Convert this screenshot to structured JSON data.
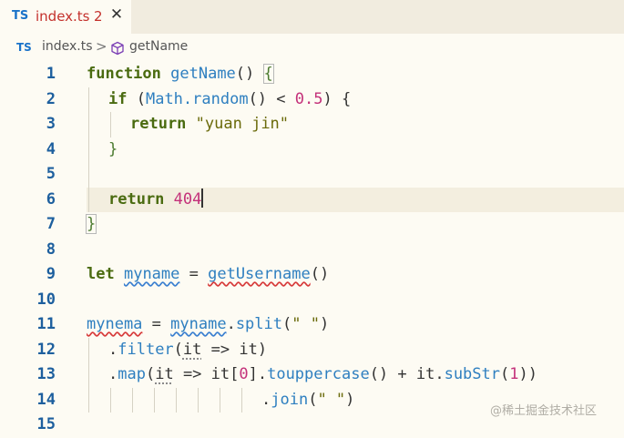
{
  "tab": {
    "lang": "TS",
    "filename": "index.ts",
    "problems": "2",
    "close_icon": "✕"
  },
  "breadcrumb": {
    "lang": "TS",
    "file": "index.ts",
    "separator": ">",
    "symbol": "getName",
    "symbol_icon": "cube-icon"
  },
  "colors": {
    "keyword": "#4a6b10",
    "function": "#2e7fc0",
    "number": "#c4317a",
    "string": "#6a6a0a",
    "error": "#d73a3a"
  },
  "editor": {
    "cursor_line": "6",
    "lines": [
      {
        "n": "1",
        "t": {
          "a": "function",
          "b": " ",
          "c": "getName",
          "d": "() ",
          "e": "{"
        }
      },
      {
        "n": "2",
        "t": {
          "a": "if",
          "b": " (",
          "c": "Math.random",
          "d": "() < ",
          "e": "0.5",
          "f": ") {"
        }
      },
      {
        "n": "3",
        "t": {
          "a": "return",
          "b": " ",
          "c": "\"yuan jin\""
        }
      },
      {
        "n": "4",
        "t": {
          "a": "}"
        }
      },
      {
        "n": "5",
        "t": {}
      },
      {
        "n": "6",
        "t": {
          "a": "return",
          "b": " ",
          "c": "404"
        }
      },
      {
        "n": "7",
        "t": {
          "a": "}"
        }
      },
      {
        "n": "8",
        "t": {}
      },
      {
        "n": "9",
        "t": {
          "a": "let",
          "b": " ",
          "c": "myname",
          "d": " = ",
          "e": "getUsername",
          "f": "()"
        }
      },
      {
        "n": "10",
        "t": {}
      },
      {
        "n": "11",
        "t": {
          "a": "mynema",
          "b": " = ",
          "c": "myname",
          "d": ".",
          "e": "split",
          "f": "(",
          "g": "\" \"",
          "h": ")"
        }
      },
      {
        "n": "12",
        "t": {
          "a": ".",
          "b": "filter",
          "c": "(",
          "d": "it",
          "e": " => it)"
        }
      },
      {
        "n": "13",
        "t": {
          "a": ".",
          "b": "map",
          "c": "(",
          "d": "it",
          "e": " => it[",
          "f": "0",
          "g": "].",
          "h": "touppercase",
          "i": "() + it.",
          "j": "subStr",
          "k": "(",
          "l": "1",
          "m": "))"
        }
      },
      {
        "n": "14",
        "t": {
          "a": ".",
          "b": "join",
          "c": "(",
          "d": "\" \"",
          "e": ")"
        }
      },
      {
        "n": "15",
        "t": {}
      }
    ]
  },
  "watermark": "@稀土掘金技术社区"
}
